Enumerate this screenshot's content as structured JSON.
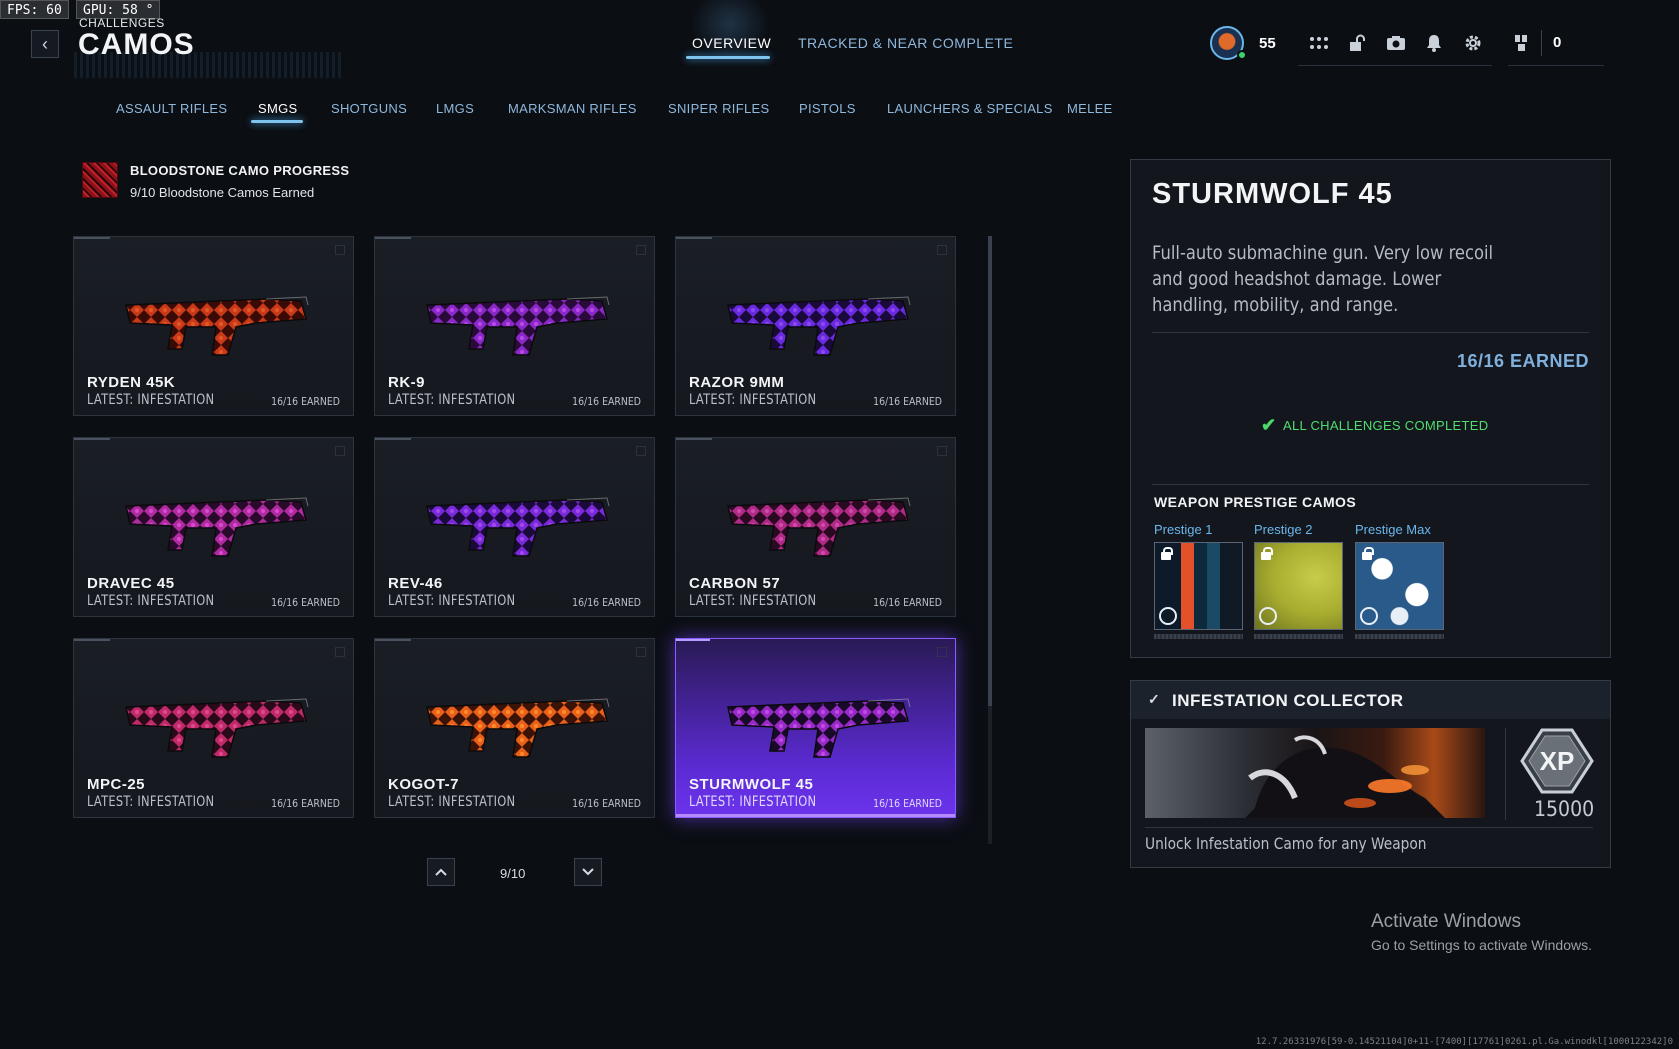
{
  "overlay": {
    "fps": "FPS:  60",
    "gpu": "GPU: 58 °"
  },
  "header": {
    "breadcrumb": "CHALLENGES",
    "title": "CAMOS",
    "tabs": [
      {
        "label": "OVERVIEW",
        "active": true
      },
      {
        "label": "TRACKED & NEAR COMPLETE",
        "active": false
      }
    ],
    "player_level": "55",
    "currency": "0"
  },
  "categories": [
    {
      "label": "ASSAULT RIFLES",
      "active": false
    },
    {
      "label": "SMGS",
      "active": true
    },
    {
      "label": "SHOTGUNS",
      "active": false
    },
    {
      "label": "LMGS",
      "active": false
    },
    {
      "label": "MARKSMAN RIFLES",
      "active": false
    },
    {
      "label": "SNIPER RIFLES",
      "active": false
    },
    {
      "label": "PISTOLS",
      "active": false
    },
    {
      "label": "LAUNCHERS & SPECIALS",
      "active": false
    },
    {
      "label": "MELEE",
      "active": false
    }
  ],
  "bloodstone": {
    "title": "BLOODSTONE CAMO PROGRESS",
    "subtitle": "9/10 Bloodstone Camos Earned"
  },
  "weapons": [
    {
      "name": "RYDEN 45K",
      "latest": "LATEST: INFESTATION",
      "earned": "16/16 EARNED"
    },
    {
      "name": "RK-9",
      "latest": "LATEST: INFESTATION",
      "earned": "16/16 EARNED"
    },
    {
      "name": "RAZOR 9MM",
      "latest": "LATEST: INFESTATION",
      "earned": "16/16 EARNED"
    },
    {
      "name": "DRAVEC 45",
      "latest": "LATEST: INFESTATION",
      "earned": "16/16 EARNED"
    },
    {
      "name": "REV-46",
      "latest": "LATEST: INFESTATION",
      "earned": "16/16 EARNED"
    },
    {
      "name": "CARBON 57",
      "latest": "LATEST: INFESTATION",
      "earned": "16/16 EARNED"
    },
    {
      "name": "MPC-25",
      "latest": "LATEST: INFESTATION",
      "earned": "16/16 EARNED"
    },
    {
      "name": "KOGOT-7",
      "latest": "LATEST: INFESTATION",
      "earned": "16/16 EARNED"
    },
    {
      "name": "STURMWOLF 45",
      "latest": "LATEST: INFESTATION",
      "earned": "16/16 EARNED"
    }
  ],
  "pagination": {
    "label": "9/10"
  },
  "detail": {
    "title": "STURMWOLF 45",
    "description": "Full-auto submachine gun. Very low recoil and good headshot damage. Lower handling, mobility, and range.",
    "earned": "16/16 EARNED",
    "status": "ALL CHALLENGES COMPLETED",
    "prestige_title": "WEAPON PRESTIGE CAMOS",
    "prestige": [
      {
        "label": "Prestige 1"
      },
      {
        "label": "Prestige 2"
      },
      {
        "label": "Prestige Max"
      }
    ]
  },
  "collector": {
    "title": "INFESTATION COLLECTOR",
    "xp_label": "XP",
    "xp_amount": "15000",
    "description": "Unlock Infestation Camo for any Weapon"
  },
  "watermark": {
    "title": "Activate Windows",
    "subtitle": "Go to Settings to activate Windows."
  },
  "footer_string": "12.7.26331976[59-0.14521104]0+11-[7400][17761]0261.pl.Ga.winodkl[1000122342]0",
  "colors": {
    "accent_blue": "#7ec4ee",
    "selected_purple": "#6c34ee",
    "success_green": "#51dd6e"
  },
  "icons": [
    "back-icon",
    "avatar-icon",
    "apps-grid-icon",
    "unlock-icon",
    "camera-icon",
    "bell-icon",
    "gear-icon",
    "operator-icon",
    "check-icon",
    "lock-icon",
    "xp-icon",
    "chevron-up-icon",
    "chevron-down-icon"
  ]
}
